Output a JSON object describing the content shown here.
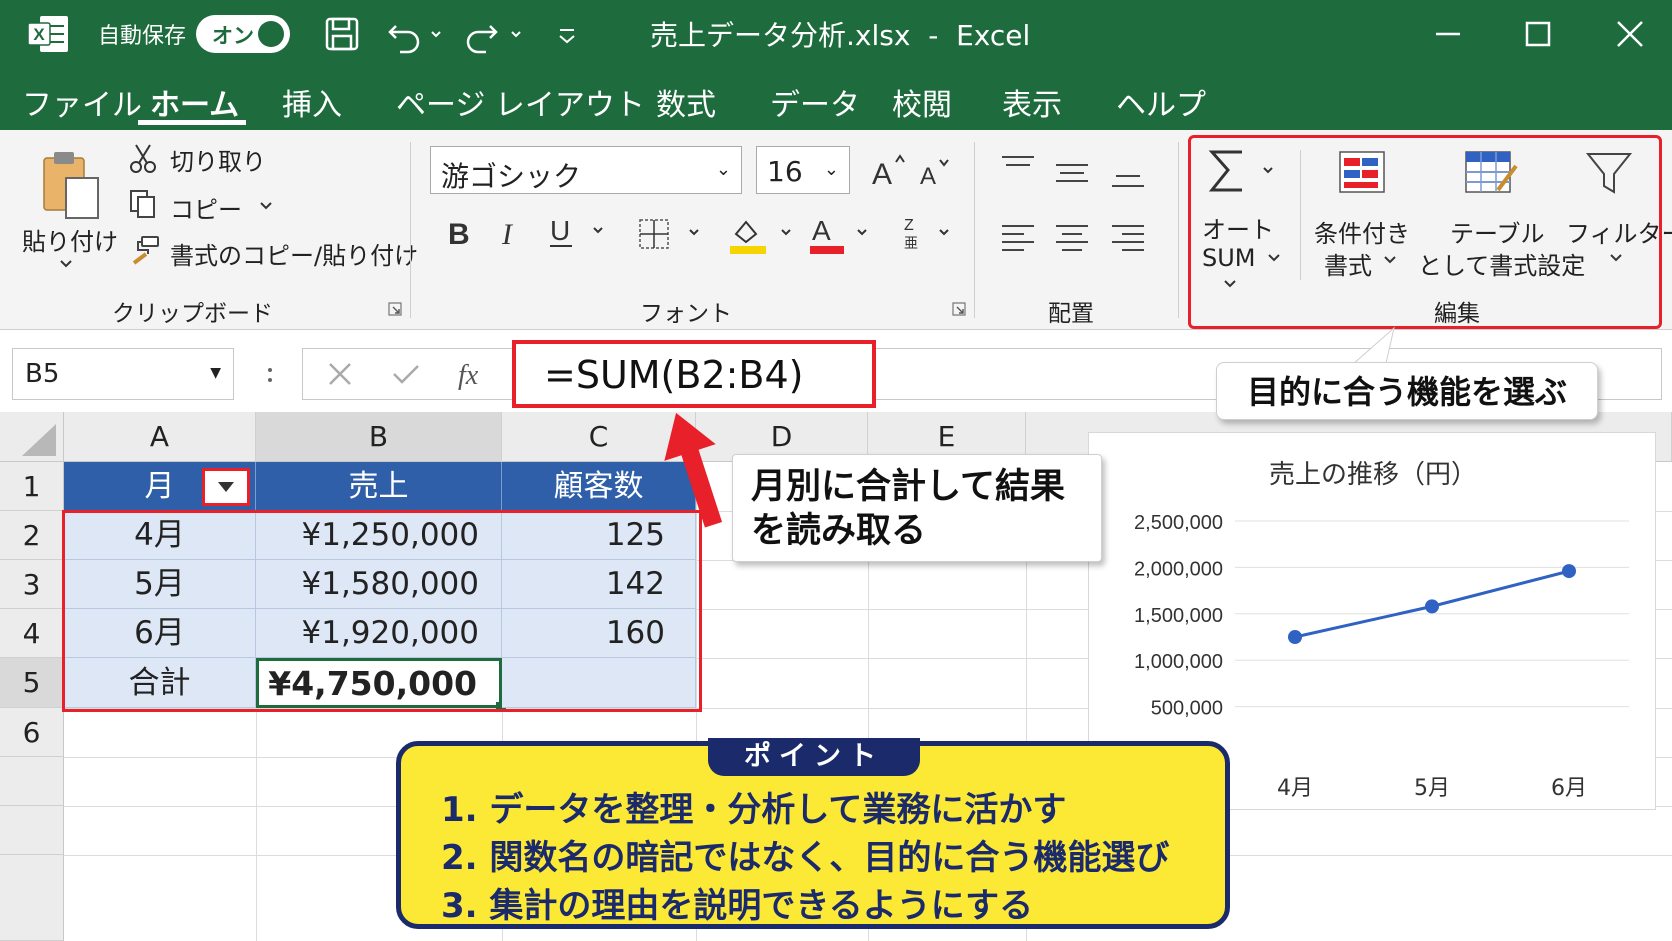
{
  "titlebar": {
    "autosave_label": "自動保存",
    "autosave_state": "オン",
    "document_title": "売上データ分析.xlsx  -  Excel"
  },
  "menu": {
    "tabs": [
      "ファイル",
      "ホーム",
      "挿入",
      "ページ レイアウト",
      "数式",
      "データ",
      "校閲",
      "表示",
      "ヘルプ"
    ],
    "active_tab": "ホーム"
  },
  "ribbon": {
    "clipboard": {
      "paste": "貼り付け",
      "cut": "切り取り",
      "copy": "コピー",
      "format_painter": "書式のコピー/貼り付け",
      "group_label": "クリップボード"
    },
    "font": {
      "font_name": "游ゴシック",
      "font_size": "16",
      "group_label": "フォント"
    },
    "alignment": {
      "group_label": "配置"
    },
    "editing": {
      "autosum_line1": "オート",
      "autosum_line2": "SUM",
      "cond_format_line1": "条件付き",
      "cond_format_line2": "書式",
      "table_format_line1": "テーブル",
      "table_format_line2": "として書式設定",
      "filter": "フィルター",
      "group_label": "編集"
    }
  },
  "formula_bar": {
    "name_box": "B5",
    "formula": "=SUM(B2:B4)"
  },
  "sheet": {
    "columns": [
      "A",
      "B",
      "C",
      "D",
      "E"
    ],
    "rows": [
      "1",
      "2",
      "3",
      "4",
      "5",
      "6"
    ],
    "headers": [
      "月",
      "売上",
      "顧客数"
    ],
    "data": [
      [
        "4月",
        "¥1,250,000",
        "125"
      ],
      [
        "5月",
        "¥1,580,000",
        "142"
      ],
      [
        "6月",
        "¥1,920,000",
        "160"
      ]
    ],
    "total_label": "合計",
    "total_value": "¥4,750,000"
  },
  "callouts": {
    "select_feature": "目的に合う機能を選ぶ",
    "read_result_line1": "月別に合計して結果",
    "read_result_line2": "を読み取る"
  },
  "chart_data": {
    "type": "line",
    "title": "売上の推移（円）",
    "categories": [
      "4月",
      "5月",
      "6月"
    ],
    "values": [
      1250000,
      1580000,
      1960000
    ],
    "yticks": [
      "2,500,000",
      "2,000,000",
      "1,500,000",
      "1,000,000",
      "500,000"
    ],
    "ylim": [
      0,
      2500000
    ],
    "color": "#2f62c2"
  },
  "point": {
    "title": "ポイント",
    "items": [
      "1. データを整理・分析して業務に活かす",
      "2. 関数名の暗記ではなく、目的に合う機能選び",
      "3. 集計の理由を説明できるようにする"
    ]
  },
  "colors": {
    "excel_green": "#1e6b3e",
    "highlight_red": "#e8202a",
    "table_header_blue": "#2f5fa8",
    "point_yellow": "#fce935",
    "point_navy": "#1b2a6b"
  }
}
